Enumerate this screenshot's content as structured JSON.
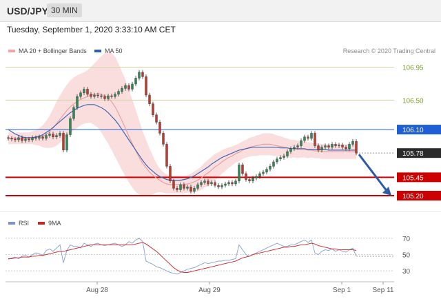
{
  "header": {
    "symbol": "USD/JPY",
    "timeframe": "30 MIN"
  },
  "datetime": "Tuesday, September 1, 2020 3:33:10 AM CET",
  "legend": {
    "items": [
      {
        "label": "MA 20 + Bollinger Bands",
        "color": "#f4a5a5"
      },
      {
        "label": "MA 50",
        "color": "#2f5db3"
      }
    ],
    "credit": "Research © 2020 Trading Central"
  },
  "rsi_legend": [
    {
      "label": "RSI",
      "color": "#7b93c9"
    },
    {
      "label": "9MA",
      "color": "#cc2222"
    }
  ],
  "colors": {
    "up": "#2e8b57",
    "down": "#c0392b",
    "resistance": "#cc0000",
    "pivot": "#1f5fd6",
    "target": "#7aa64a"
  },
  "chart_data": [
    {
      "type": "line",
      "name": "USD/JPY 30 MIN",
      "x_ticks": [
        "Aug 28",
        "Aug 29",
        "Sep 1",
        "Sep 11"
      ],
      "y_range": [
        105.05,
        107.02
      ],
      "price_levels": [
        {
          "label": "106.95",
          "value": 106.95,
          "kind": "target"
        },
        {
          "label": "106.50",
          "value": 106.5,
          "kind": "target"
        },
        {
          "label": "106.10",
          "value": 106.1,
          "kind": "pivot"
        },
        {
          "label": "105.78",
          "value": 105.78,
          "kind": "last"
        },
        {
          "label": "105.45",
          "value": 105.45,
          "kind": "support"
        },
        {
          "label": "105.20",
          "value": 105.2,
          "kind": "support"
        }
      ],
      "close": [
        105.98,
        105.97,
        105.96,
        105.99,
        105.95,
        105.97,
        105.96,
        105.99,
        105.98,
        106.0,
        105.98,
        106.02,
        106.04,
        106.0,
        106.02,
        106.05,
        105.82,
        106.03,
        106.25,
        106.4,
        106.55,
        106.6,
        106.65,
        106.58,
        106.55,
        106.57,
        106.56,
        106.55,
        106.52,
        106.56,
        106.55,
        106.58,
        106.62,
        106.66,
        106.7,
        106.65,
        106.72,
        106.8,
        106.88,
        106.82,
        106.57,
        106.45,
        106.3,
        106.2,
        106.05,
        105.9,
        105.6,
        105.4,
        105.3,
        105.28,
        105.35,
        105.3,
        105.32,
        105.26,
        105.3,
        105.35,
        105.38,
        105.4,
        105.36,
        105.38,
        105.34,
        105.32,
        105.34,
        105.36,
        105.38,
        105.36,
        105.4,
        105.62,
        105.5,
        105.42,
        105.4,
        105.44,
        105.46,
        105.5,
        105.52,
        105.56,
        105.6,
        105.66,
        105.7,
        105.72,
        105.74,
        105.8,
        105.84,
        105.86,
        105.88,
        105.95,
        106.0,
        105.98,
        106.05,
        105.88,
        105.82,
        105.86,
        105.88,
        105.86,
        105.9,
        105.88,
        105.89,
        105.86,
        105.84,
        105.9,
        105.94,
        105.78
      ],
      "ma20": [
        105.98,
        105.98,
        105.98,
        105.98,
        105.98,
        105.98,
        105.98,
        105.99,
        105.99,
        106.0,
        106.01,
        106.03,
        106.07,
        106.12,
        106.18,
        106.24,
        106.3,
        106.36,
        106.41,
        106.45,
        106.48,
        106.51,
        106.53,
        106.55,
        106.57,
        106.58,
        106.59,
        106.58,
        106.56,
        106.53,
        106.48,
        106.41,
        106.32,
        106.22,
        106.12,
        106.01,
        105.91,
        105.81,
        105.72,
        105.64,
        105.58,
        105.52,
        105.48,
        105.44,
        105.41,
        105.38,
        105.36,
        105.35,
        105.35,
        105.35,
        105.35,
        105.35,
        105.36,
        105.37,
        105.39,
        105.41,
        105.44,
        105.48,
        105.51,
        105.55,
        105.59,
        105.62,
        105.66,
        105.69,
        105.72,
        105.74,
        105.77,
        105.79,
        105.82,
        105.84,
        105.86,
        105.87,
        105.88,
        105.89,
        105.9,
        105.9,
        105.9,
        105.89,
        105.88,
        105.87,
        105.86,
        105.85,
        105.84,
        105.84,
        105.83,
        105.83,
        105.83,
        105.82,
        105.82,
        105.81,
        105.81,
        105.8,
        105.8,
        105.8,
        105.8,
        105.8,
        105.8,
        105.8,
        105.8,
        105.8,
        105.8,
        105.8
      ],
      "ma50": [
        106.1,
        106.07,
        106.04,
        106.02,
        106.0,
        105.99,
        105.99,
        105.99,
        106.0,
        106.01,
        106.03,
        106.06,
        106.09,
        106.13,
        106.17,
        106.21,
        106.25,
        106.29,
        106.33,
        106.36,
        106.39,
        106.41,
        106.43,
        106.44,
        106.44,
        106.44,
        106.42,
        106.4,
        106.37,
        106.33,
        106.28,
        106.23,
        106.17,
        106.1,
        106.03,
        105.96,
        105.89,
        105.82,
        105.75,
        105.68,
        105.62,
        105.57,
        105.53,
        105.49,
        105.46,
        105.44,
        105.42,
        105.41,
        105.41,
        105.41,
        105.41,
        105.42,
        105.43,
        105.45,
        105.47,
        105.5,
        105.53,
        105.56,
        105.59,
        105.63,
        105.66,
        105.69,
        105.72,
        105.74,
        105.76,
        105.78,
        105.8,
        105.82,
        105.83,
        105.84,
        105.85,
        105.86,
        105.86,
        105.86,
        105.86,
        105.86,
        105.86,
        105.86,
        105.86,
        105.85,
        105.85,
        105.85,
        105.84,
        105.84,
        105.84,
        105.84,
        105.84,
        105.83,
        105.83,
        105.83,
        105.83,
        105.83,
        105.83,
        105.82,
        105.82,
        105.82,
        105.82,
        105.82,
        105.82,
        105.82,
        105.82,
        105.82
      ],
      "bb_width": [
        0.08,
        0.08,
        0.08,
        0.08,
        0.08,
        0.08,
        0.08,
        0.09,
        0.1,
        0.12,
        0.15,
        0.18,
        0.22,
        0.26,
        0.3,
        0.32,
        0.34,
        0.35,
        0.36,
        0.36,
        0.36,
        0.35,
        0.35,
        0.36,
        0.38,
        0.42,
        0.46,
        0.52,
        0.58,
        0.62,
        0.66,
        0.68,
        0.68,
        0.67,
        0.66,
        0.63,
        0.6,
        0.56,
        0.5,
        0.44,
        0.38,
        0.32,
        0.26,
        0.2,
        0.16,
        0.14,
        0.13,
        0.12,
        0.12,
        0.12,
        0.12,
        0.12,
        0.12,
        0.13,
        0.14,
        0.15,
        0.16,
        0.17,
        0.18,
        0.18,
        0.18,
        0.17,
        0.16,
        0.15,
        0.14,
        0.13,
        0.12,
        0.12,
        0.12,
        0.12,
        0.13,
        0.13,
        0.14,
        0.14,
        0.15,
        0.15,
        0.15,
        0.15,
        0.14,
        0.14,
        0.13,
        0.13,
        0.12,
        0.12,
        0.12,
        0.11,
        0.11,
        0.11,
        0.1,
        0.1,
        0.1,
        0.1,
        0.1,
        0.1,
        0.1,
        0.1,
        0.1,
        0.1,
        0.1,
        0.1,
        0.1,
        0.1
      ],
      "forecast": {
        "from": 105.78,
        "to": 105.2,
        "bars": 6
      }
    },
    {
      "type": "line",
      "name": "RSI",
      "y_ticks": [
        70,
        50,
        30
      ],
      "y_range": [
        20,
        75
      ],
      "rsi": [
        44,
        46,
        47,
        45,
        48,
        49,
        47,
        50,
        52,
        51,
        49,
        55,
        57,
        54,
        58,
        62,
        40,
        55,
        62,
        60,
        60,
        58,
        64,
        62,
        60,
        63,
        64,
        62,
        61,
        62,
        63,
        64,
        62,
        60,
        62,
        66,
        64,
        68,
        70,
        66,
        42,
        40,
        38,
        35,
        34,
        32,
        30,
        28,
        27,
        26,
        28,
        30,
        32,
        33,
        34,
        36,
        38,
        40,
        39,
        40,
        41,
        42,
        42,
        43,
        43,
        44,
        45,
        62,
        56,
        50,
        48,
        50,
        52,
        54,
        56,
        58,
        60,
        62,
        64,
        62,
        60,
        60,
        62,
        62,
        64,
        66,
        68,
        65,
        68,
        52,
        50,
        54,
        56,
        55,
        57,
        54,
        56,
        54,
        53,
        56,
        58,
        48
      ],
      "rsi_ma": [
        45,
        45,
        46,
        46,
        47,
        47,
        47,
        48,
        48,
        49,
        49,
        50,
        51,
        52,
        53,
        54,
        54,
        55,
        56,
        57,
        58,
        59,
        60,
        61,
        62,
        62,
        62,
        62,
        62,
        62,
        62,
        62,
        62,
        62,
        62,
        62,
        62,
        63,
        64,
        65,
        63,
        60,
        57,
        54,
        50,
        46,
        42,
        38,
        34,
        31,
        29,
        28,
        28,
        29,
        30,
        31,
        32,
        33,
        34,
        35,
        36,
        37,
        38,
        39,
        40,
        41,
        42,
        44,
        46,
        47,
        48,
        50,
        51,
        52,
        53,
        54,
        55,
        56,
        57,
        58,
        59,
        59,
        60,
        60,
        61,
        62,
        62,
        63,
        64,
        63,
        61,
        60,
        59,
        58,
        57,
        57,
        56,
        56,
        56,
        56,
        56,
        55
      ]
    }
  ]
}
